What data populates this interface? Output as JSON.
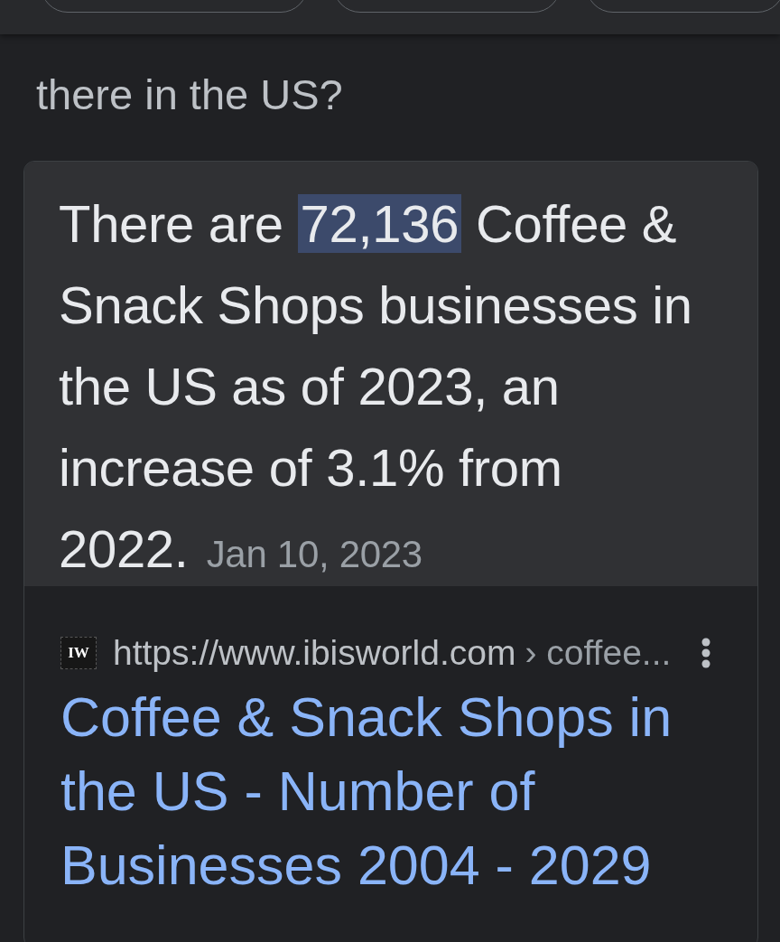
{
  "header": {
    "chips": [
      {
        "kind": "chip"
      },
      {
        "kind": "chip"
      },
      {
        "kind": "chip"
      }
    ]
  },
  "question": "there in the US?",
  "answer": {
    "before": "There are ",
    "highlight": "72,136",
    "after": " Coffee & Snack Shops businesses in the US as of 2023, an increase of 3.1% from 2022.",
    "date": "Jan 10, 2023"
  },
  "source": {
    "favicon": "IW",
    "url": "https://www.ibisworld.com",
    "path": "› coffee...",
    "title": "Coffee & Snack Shops in the US - Number of Businesses 2004 - 2029"
  }
}
